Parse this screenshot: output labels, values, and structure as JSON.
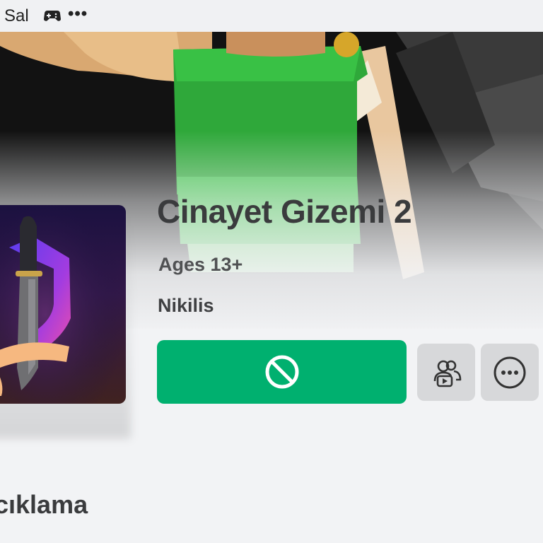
{
  "status_bar": {
    "day_label": "Sal",
    "controller_icon": "gamepad-icon",
    "more_icon": "more-horizontal-icon",
    "more_glyph": "•••"
  },
  "game": {
    "title": "Cinayet Gizemi 2",
    "age_rating": "Ages 13+",
    "creator": "Nikilis"
  },
  "actions": {
    "play_icon": "blocked-icon",
    "party_icon": "party-icon",
    "more_icon": "ellipsis-circle-icon"
  },
  "description_section": {
    "heading": "cıklama"
  },
  "colors": {
    "play_button": "#00b06f",
    "secondary_button": "#d7d8da",
    "page_background": "#f2f3f5",
    "text_primary": "#3a3b3d"
  }
}
